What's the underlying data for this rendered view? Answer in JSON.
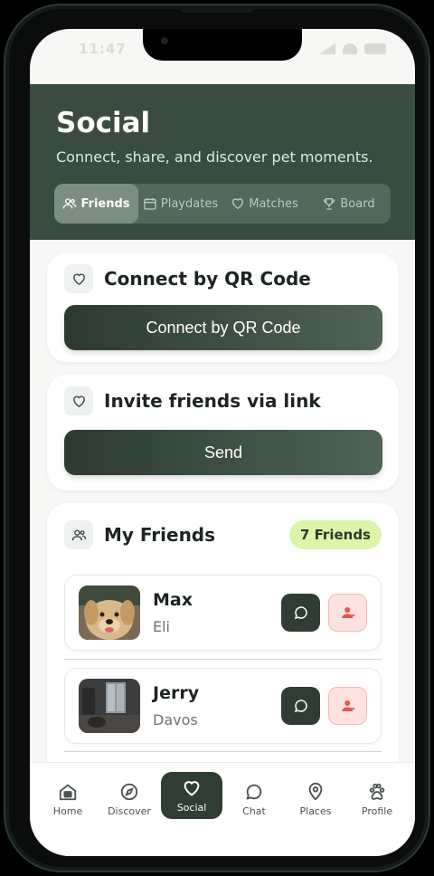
{
  "status": {
    "time": "11:47"
  },
  "header": {
    "title": "Social",
    "subtitle": "Connect, share, and discover pet moments.",
    "tabs": [
      {
        "label": "Friends",
        "icon": "users-icon",
        "active": true
      },
      {
        "label": "Playdates",
        "icon": "calendar-icon",
        "active": false
      },
      {
        "label": "Matches",
        "icon": "heart-icon",
        "active": false
      },
      {
        "label": "Board",
        "icon": "trophy-icon",
        "active": false
      }
    ]
  },
  "qr_card": {
    "title": "Connect by QR Code",
    "button": "Connect by QR Code",
    "icon": "heart-icon"
  },
  "invite_card": {
    "title": "Invite friends via link",
    "button": "Send",
    "icon": "heart-icon"
  },
  "friends_card": {
    "title": "My Friends",
    "icon": "users-icon",
    "badge": "7 Friends",
    "friends": [
      {
        "name": "Max",
        "owner": "Eli",
        "avatar": "golden-retriever-photo"
      },
      {
        "name": "Jerry",
        "owner": "Davos",
        "avatar": "room-photo"
      }
    ]
  },
  "nav": {
    "items": [
      {
        "label": "Home",
        "icon": "home-icon",
        "active": false
      },
      {
        "label": "Discover",
        "icon": "compass-icon",
        "active": false
      },
      {
        "label": "Social",
        "icon": "heart-icon",
        "active": true
      },
      {
        "label": "Chat",
        "icon": "chat-bubble-icon",
        "active": false
      },
      {
        "label": "Places",
        "icon": "map-pin-icon",
        "active": false
      },
      {
        "label": "Profile",
        "icon": "paw-icon",
        "active": false
      }
    ]
  },
  "colors": {
    "header_bg": "#3a4b40",
    "accent": "#2f3d34",
    "badge_bg": "#dcf5a8",
    "remove_bg": "#fde2e0",
    "remove_icon": "#e5534b"
  }
}
